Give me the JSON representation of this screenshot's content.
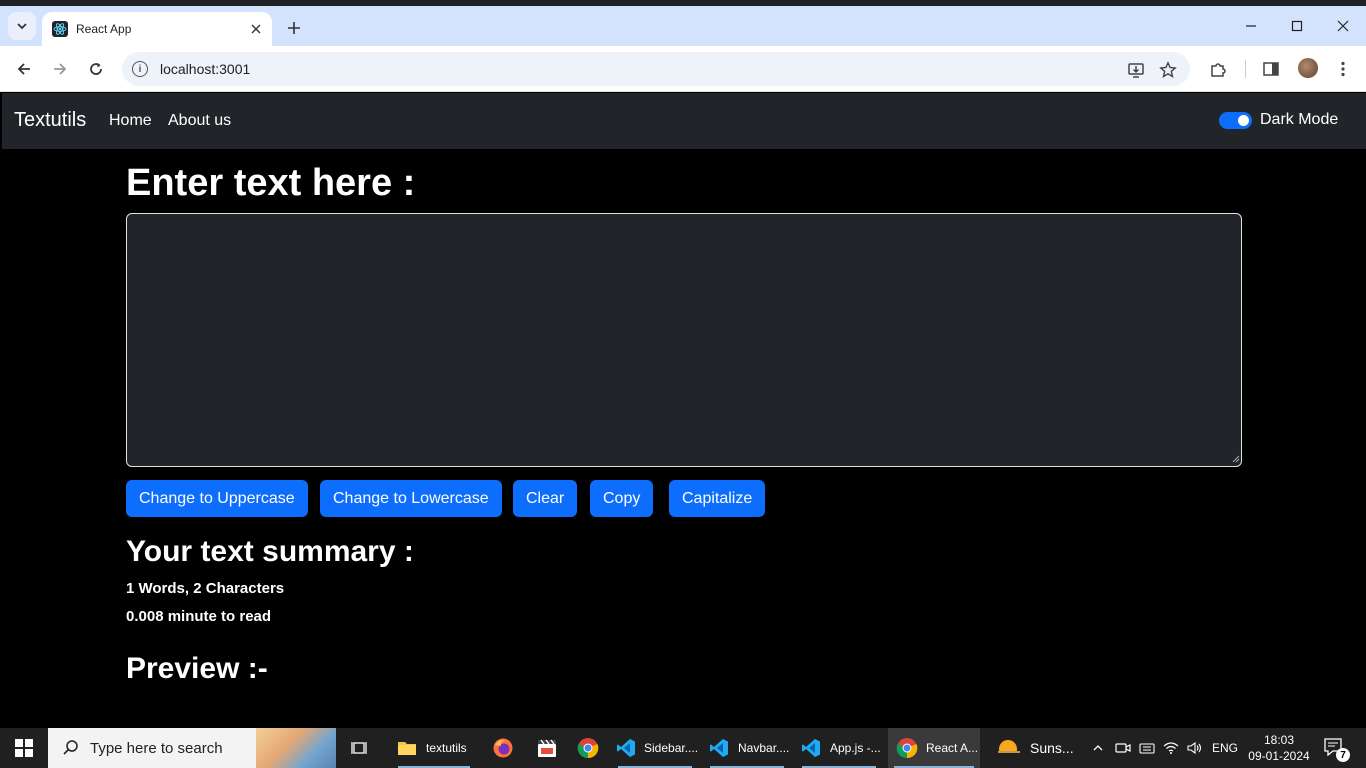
{
  "browser": {
    "tab_title": "React App",
    "url": "localhost:3001"
  },
  "app": {
    "brand": "Textutils",
    "nav_links": [
      "Home",
      "About us"
    ],
    "dark_mode_label": "Dark Mode",
    "dark_mode_on": true,
    "heading": "Enter text here :",
    "textarea_value": "",
    "buttons": [
      "Change to Uppercase",
      "Change to Lowercase",
      "Clear",
      "Copy",
      "Capitalize"
    ],
    "summary_heading": "Your text summary :",
    "summary_counts": "1 Words, 2 Characters",
    "summary_read": "0.008 minute to read",
    "preview_heading": "Preview :-",
    "accent_color": "#0d6efd"
  },
  "taskbar": {
    "search_placeholder": "Type here to search",
    "items": [
      {
        "label": "textutils",
        "icon": "folder-icon"
      },
      {
        "label": "",
        "icon": "firefox-icon"
      },
      {
        "label": "",
        "icon": "clapperboard-icon"
      },
      {
        "label": "",
        "icon": "chrome-icon"
      },
      {
        "label": "Sidebar....",
        "icon": "vscode-icon"
      },
      {
        "label": "Navbar....",
        "icon": "vscode-icon"
      },
      {
        "label": "App.js -...",
        "icon": "vscode-icon"
      },
      {
        "label": "React A...",
        "icon": "chrome-icon"
      },
      {
        "label": "Suns...",
        "icon": "weather-icon"
      }
    ],
    "language": "ENG",
    "time": "18:03",
    "date": "09-01-2024",
    "notification_count": "7"
  }
}
